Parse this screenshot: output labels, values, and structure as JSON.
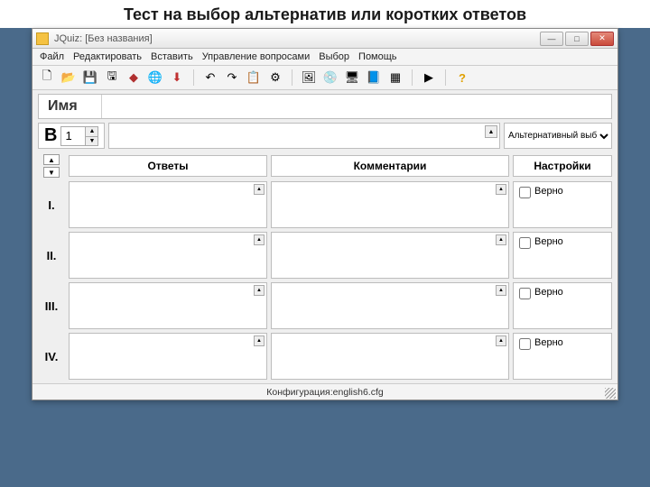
{
  "slide_title": "Тест на выбор альтернатив или коротких ответов",
  "window": {
    "title": "JQuiz: [Без названия]",
    "min": "—",
    "max": "□",
    "close": "✕"
  },
  "menu": {
    "file": "Файл",
    "edit": "Редактировать",
    "insert": "Вставить",
    "manage": "Управление вопросами",
    "select": "Выбор",
    "help": "Помощь"
  },
  "toolbar_icons": {
    "new": "🗋",
    "open": "📂",
    "save": "💾",
    "saveas": "🖫",
    "diamond": "◆",
    "web": "🌐",
    "down": "⬇",
    "undo": "↶",
    "redo": "↷",
    "paste": "📋",
    "config": "⚙",
    "img": "🖼",
    "disk": "💿",
    "screen": "🖥",
    "book": "📘",
    "grid": "▦",
    "play": "▶",
    "question": "?"
  },
  "name_label": "Имя",
  "question_prefix": "В",
  "question_number": "1",
  "qtype_selected": "Альтернативный выб",
  "columns": {
    "answers": "Ответы",
    "comments": "Комментарии",
    "settings": "Настройки"
  },
  "correct_label": "Верно",
  "rows": [
    {
      "roman": "I."
    },
    {
      "roman": "II."
    },
    {
      "roman": "III."
    },
    {
      "roman": "IV."
    }
  ],
  "status_prefix": "Конфигурация: ",
  "status_value": "english6.cfg"
}
